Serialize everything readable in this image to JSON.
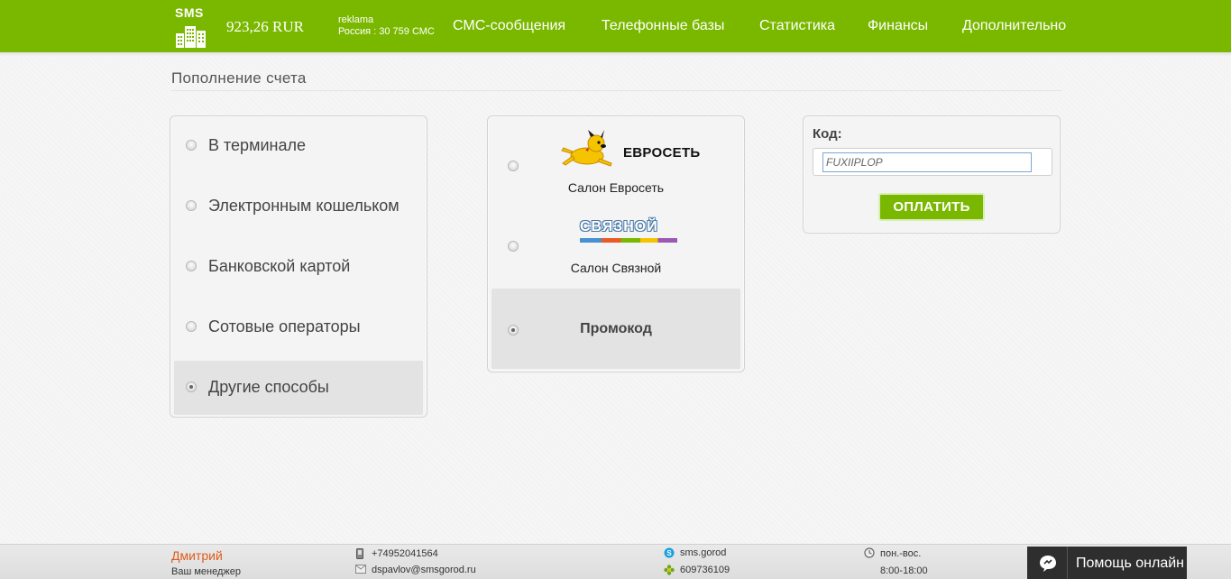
{
  "header": {
    "logo_text": "SMS",
    "balance": "923,26 RUR",
    "account_login": "reklama",
    "account_region": "Россия : 30 759 СМС",
    "nav": [
      {
        "label": "СМС-сообщения"
      },
      {
        "label": "Телефонные базы"
      },
      {
        "label": "Статистика"
      },
      {
        "label": "Финансы"
      },
      {
        "label": "Дополнительно"
      }
    ]
  },
  "page_title": "Пополнение счета",
  "methods": [
    {
      "label": "В терминале",
      "selected": false
    },
    {
      "label": "Электронным кошельком",
      "selected": false
    },
    {
      "label": "Банковской картой",
      "selected": false
    },
    {
      "label": "Сотовые операторы",
      "selected": false
    },
    {
      "label": "Другие способы",
      "selected": true
    }
  ],
  "salons": [
    {
      "logo_text": "ЕВРОСЕТЬ",
      "caption": "Салон Евросеть",
      "icon": "euroset-dog-logo",
      "selected": false
    },
    {
      "logo_text": "СВЯЗНОЙ",
      "caption": "Салон Связной",
      "icon": "svyaznoy-logo",
      "selected": false
    },
    {
      "caption": "Промокод",
      "selected": true
    }
  ],
  "promo": {
    "label": "Код:",
    "value": "FUXIIPLOP",
    "pay_button": "ОПЛАТИТЬ"
  },
  "footer": {
    "manager_name": "Дмитрий",
    "manager_role": "Ваш менеджер",
    "phone": "+74952041564",
    "email": "dspavlov@smsgorod.ru",
    "skype": "sms.gorod",
    "icq": "609736109",
    "days": "пон.-вос.",
    "hours": "8:00-18:00",
    "help": "Помощь онлайн"
  },
  "colors": {
    "brand_green": "#7ab800",
    "manager_orange": "#e05a1c",
    "help_dark": "#2e2e2e"
  }
}
